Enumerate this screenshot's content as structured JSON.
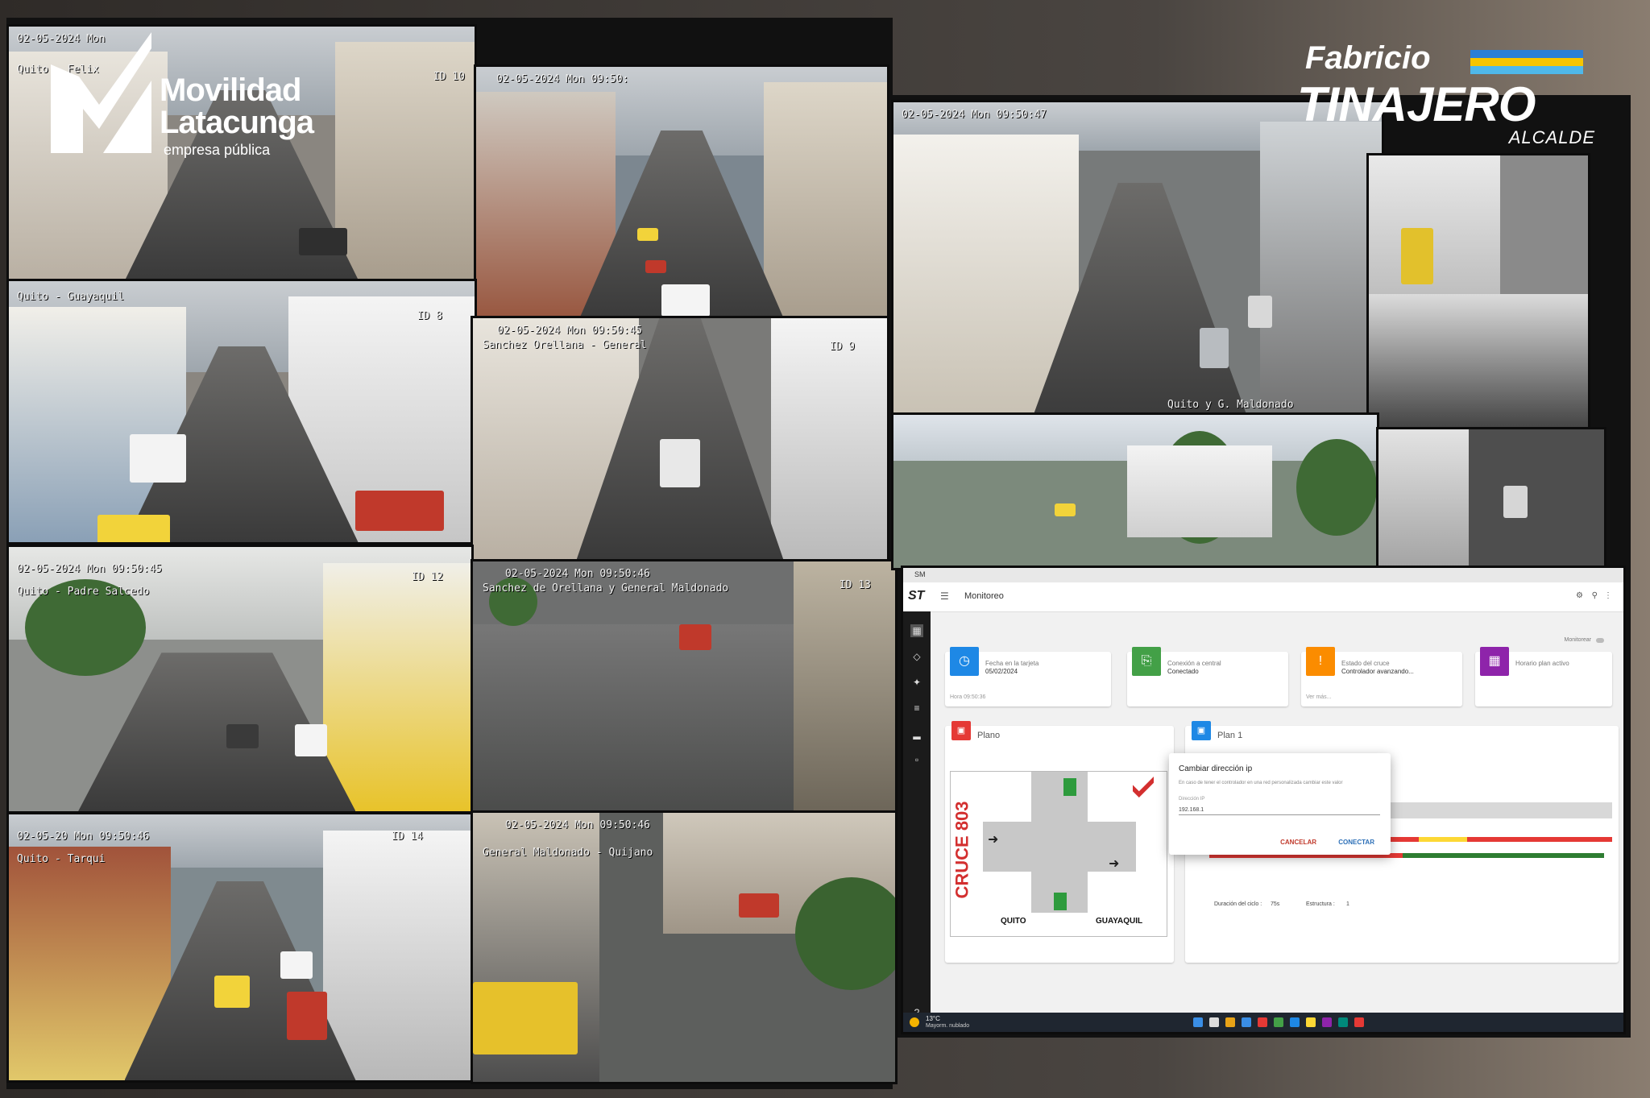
{
  "branding": {
    "left_logo_line1": "Movilidad",
    "left_logo_line2": "Latacunga",
    "left_logo_line3": "empresa pública",
    "right_logo_line1": "Fabricio",
    "right_logo_line2": "TINAJERO",
    "right_logo_line3": "ALCALDE",
    "colors": {
      "flag_yellow": "#f6c500",
      "flag_blue": "#2b7fd6",
      "flag_cyan": "#4fb8ea"
    }
  },
  "cameras": [
    {
      "osd": "02-05-2024 Mon",
      "label": "Quito - Felix",
      "id": "ID 10"
    },
    {
      "osd": "02-05-2024 Mon 09:50:",
      "label": "",
      "id": ""
    },
    {
      "osd": "02-05-2024 Mon 09:50:47",
      "label": "Quito y G. Maldonado",
      "id": ""
    },
    {
      "osd": "",
      "label": "Quito - Guayaquil",
      "id": "ID 8"
    },
    {
      "osd": "02-05-2024 Mon 09:50:45",
      "label": "Sanchez Orellana - General",
      "id": "ID 9"
    },
    {
      "osd": "02-05-2024 Mon 09:50:45",
      "label": "Quito - Padre Salcedo",
      "id": "ID 12"
    },
    {
      "osd": "02-05-2024 Mon 09:50:46",
      "label": "Sanchez de Orellana y General Maldonado",
      "id": "ID 13"
    },
    {
      "osd": "02-05-20 Mon 09:50:46",
      "label": "Quito - Tarqui",
      "id": "ID 14"
    },
    {
      "osd": "02-05-2024 Mon 09:50:46",
      "label": "General Maldonado - Quijano",
      "id": ""
    }
  ],
  "app": {
    "window_title": "SM",
    "page_title": "Monitoreo",
    "logo": "ST",
    "monitor_label": "Monitorear",
    "cards": [
      {
        "title": "Fecha en la tarjeta",
        "value": "05/02/2024",
        "footer": "Hora 09:50:36",
        "color": "#1e88e5",
        "icon": "clock-icon"
      },
      {
        "title": "Conexión a central",
        "value": "Conectado",
        "footer": "",
        "color": "#43a047",
        "icon": "cast-icon"
      },
      {
        "title": "Estado del cruce",
        "value": "Controlador avanzando...",
        "footer": "Ver más...",
        "color": "#fb8c00",
        "icon": "alert-icon"
      },
      {
        "title": "Horario plan activo",
        "value": "",
        "footer": "",
        "color": "#8e24aa",
        "icon": "calendar-icon"
      }
    ],
    "plano_title": "Plano",
    "plan_title": "Plan 1",
    "crossing_label": "CRUCE 803",
    "street_left": "QUITO",
    "street_right": "GUAYAQUIL",
    "cycle_label": "Duración del ciclo :",
    "cycle_value": "75s",
    "structure_label": "Estructura :",
    "structure_value": "1",
    "dialog": {
      "title": "Cambiar dirección ip",
      "description": "En caso de tener el controlador en una red personalizada cambiar este valor",
      "field_label": "Dirección IP",
      "field_value": "192.168.1",
      "cancel": "CANCELAR",
      "connect": "CONECTAR"
    },
    "taskbar": {
      "temperature": "13°C",
      "weather": "Mayorm. nublado"
    }
  }
}
